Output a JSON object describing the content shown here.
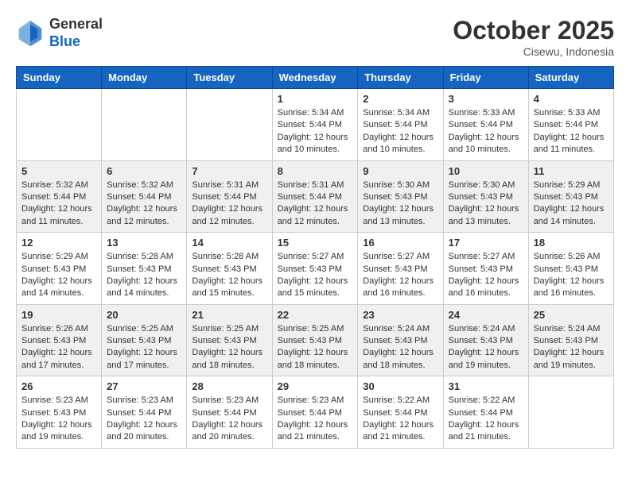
{
  "header": {
    "logo_general": "General",
    "logo_blue": "Blue",
    "month_year": "October 2025",
    "location": "Cisewu, Indonesia"
  },
  "weekdays": [
    "Sunday",
    "Monday",
    "Tuesday",
    "Wednesday",
    "Thursday",
    "Friday",
    "Saturday"
  ],
  "weeks": [
    [
      {
        "day": "",
        "info": ""
      },
      {
        "day": "",
        "info": ""
      },
      {
        "day": "",
        "info": ""
      },
      {
        "day": "1",
        "info": "Sunrise: 5:34 AM\nSunset: 5:44 PM\nDaylight: 12 hours\nand 10 minutes."
      },
      {
        "day": "2",
        "info": "Sunrise: 5:34 AM\nSunset: 5:44 PM\nDaylight: 12 hours\nand 10 minutes."
      },
      {
        "day": "3",
        "info": "Sunrise: 5:33 AM\nSunset: 5:44 PM\nDaylight: 12 hours\nand 10 minutes."
      },
      {
        "day": "4",
        "info": "Sunrise: 5:33 AM\nSunset: 5:44 PM\nDaylight: 12 hours\nand 11 minutes."
      }
    ],
    [
      {
        "day": "5",
        "info": "Sunrise: 5:32 AM\nSunset: 5:44 PM\nDaylight: 12 hours\nand 11 minutes."
      },
      {
        "day": "6",
        "info": "Sunrise: 5:32 AM\nSunset: 5:44 PM\nDaylight: 12 hours\nand 12 minutes."
      },
      {
        "day": "7",
        "info": "Sunrise: 5:31 AM\nSunset: 5:44 PM\nDaylight: 12 hours\nand 12 minutes."
      },
      {
        "day": "8",
        "info": "Sunrise: 5:31 AM\nSunset: 5:44 PM\nDaylight: 12 hours\nand 12 minutes."
      },
      {
        "day": "9",
        "info": "Sunrise: 5:30 AM\nSunset: 5:43 PM\nDaylight: 12 hours\nand 13 minutes."
      },
      {
        "day": "10",
        "info": "Sunrise: 5:30 AM\nSunset: 5:43 PM\nDaylight: 12 hours\nand 13 minutes."
      },
      {
        "day": "11",
        "info": "Sunrise: 5:29 AM\nSunset: 5:43 PM\nDaylight: 12 hours\nand 14 minutes."
      }
    ],
    [
      {
        "day": "12",
        "info": "Sunrise: 5:29 AM\nSunset: 5:43 PM\nDaylight: 12 hours\nand 14 minutes."
      },
      {
        "day": "13",
        "info": "Sunrise: 5:28 AM\nSunset: 5:43 PM\nDaylight: 12 hours\nand 14 minutes."
      },
      {
        "day": "14",
        "info": "Sunrise: 5:28 AM\nSunset: 5:43 PM\nDaylight: 12 hours\nand 15 minutes."
      },
      {
        "day": "15",
        "info": "Sunrise: 5:27 AM\nSunset: 5:43 PM\nDaylight: 12 hours\nand 15 minutes."
      },
      {
        "day": "16",
        "info": "Sunrise: 5:27 AM\nSunset: 5:43 PM\nDaylight: 12 hours\nand 16 minutes."
      },
      {
        "day": "17",
        "info": "Sunrise: 5:27 AM\nSunset: 5:43 PM\nDaylight: 12 hours\nand 16 minutes."
      },
      {
        "day": "18",
        "info": "Sunrise: 5:26 AM\nSunset: 5:43 PM\nDaylight: 12 hours\nand 16 minutes."
      }
    ],
    [
      {
        "day": "19",
        "info": "Sunrise: 5:26 AM\nSunset: 5:43 PM\nDaylight: 12 hours\nand 17 minutes."
      },
      {
        "day": "20",
        "info": "Sunrise: 5:25 AM\nSunset: 5:43 PM\nDaylight: 12 hours\nand 17 minutes."
      },
      {
        "day": "21",
        "info": "Sunrise: 5:25 AM\nSunset: 5:43 PM\nDaylight: 12 hours\nand 18 minutes."
      },
      {
        "day": "22",
        "info": "Sunrise: 5:25 AM\nSunset: 5:43 PM\nDaylight: 12 hours\nand 18 minutes."
      },
      {
        "day": "23",
        "info": "Sunrise: 5:24 AM\nSunset: 5:43 PM\nDaylight: 12 hours\nand 18 minutes."
      },
      {
        "day": "24",
        "info": "Sunrise: 5:24 AM\nSunset: 5:43 PM\nDaylight: 12 hours\nand 19 minutes."
      },
      {
        "day": "25",
        "info": "Sunrise: 5:24 AM\nSunset: 5:43 PM\nDaylight: 12 hours\nand 19 minutes."
      }
    ],
    [
      {
        "day": "26",
        "info": "Sunrise: 5:23 AM\nSunset: 5:43 PM\nDaylight: 12 hours\nand 19 minutes."
      },
      {
        "day": "27",
        "info": "Sunrise: 5:23 AM\nSunset: 5:44 PM\nDaylight: 12 hours\nand 20 minutes."
      },
      {
        "day": "28",
        "info": "Sunrise: 5:23 AM\nSunset: 5:44 PM\nDaylight: 12 hours\nand 20 minutes."
      },
      {
        "day": "29",
        "info": "Sunrise: 5:23 AM\nSunset: 5:44 PM\nDaylight: 12 hours\nand 21 minutes."
      },
      {
        "day": "30",
        "info": "Sunrise: 5:22 AM\nSunset: 5:44 PM\nDaylight: 12 hours\nand 21 minutes."
      },
      {
        "day": "31",
        "info": "Sunrise: 5:22 AM\nSunset: 5:44 PM\nDaylight: 12 hours\nand 21 minutes."
      },
      {
        "day": "",
        "info": ""
      }
    ]
  ]
}
